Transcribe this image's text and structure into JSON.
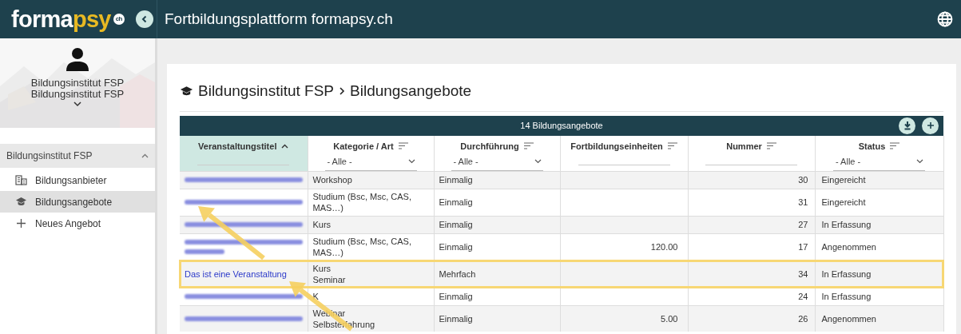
{
  "header": {
    "logo": {
      "brand": "forma",
      "accent": "psy",
      "badge": "ch"
    },
    "title": "Fortbildungsplattform formapsy.ch"
  },
  "profile": {
    "lines": [
      "Bildungsinstitut FSP",
      "Bildungsinstitut FSP"
    ]
  },
  "nav": {
    "group": {
      "label": "Bildungsinstitut FSP",
      "expanded": true
    },
    "items": [
      {
        "kind": "building",
        "label": "Bildungsanbieter",
        "selected": false
      },
      {
        "kind": "cap",
        "label": "Bildungsangebote",
        "selected": true
      },
      {
        "kind": "plus",
        "label": "Neues Angebot",
        "selected": false
      }
    ]
  },
  "breadcrumb": [
    "Bildungsinstitut FSP",
    "Bildungsangebote"
  ],
  "table": {
    "caption": "14 Bildungsangebote",
    "columns": [
      {
        "label": "Veranstaltungstitel",
        "sorted": true
      },
      {
        "label": "Kategorie / Art",
        "sorted": false,
        "filter": "- Alle -"
      },
      {
        "label": "Durchführung",
        "sorted": false,
        "filter": "- Alle -"
      },
      {
        "label": "Fortbildungseinheiten",
        "sorted": false
      },
      {
        "label": "Nummer",
        "sorted": false
      },
      {
        "label": "Status",
        "sorted": false,
        "filter": "- Alle -"
      }
    ],
    "rows": [
      {
        "kind": "blurred",
        "category": [
          "Workshop"
        ],
        "mode": "Einmalig",
        "units": "",
        "number": "30",
        "status": "Eingereicht",
        "highlighted": false
      },
      {
        "kind": "blurred",
        "category": [
          "Studium (Bsc, Msc, CAS, MAS…)"
        ],
        "mode": "Einmalig",
        "units": "",
        "number": "31",
        "status": "Eingereicht",
        "highlighted": false
      },
      {
        "kind": "blurred",
        "category": [
          "Kurs"
        ],
        "mode": "Einmalig",
        "units": "",
        "number": "27",
        "status": "In Erfassung",
        "highlighted": false
      },
      {
        "kind": "blurredpair",
        "category": [
          "Studium (Bsc, Msc, CAS, MAS…)"
        ],
        "mode": "Einmalig",
        "units": "120.00",
        "number": "17",
        "status": "Angenommen",
        "highlighted": false
      },
      {
        "kind": "link",
        "title": "Das ist eine Veranstaltung",
        "category": [
          "Kurs",
          "Seminar"
        ],
        "mode": "Mehrfach",
        "units": "",
        "number": "34",
        "status": "In Erfassung",
        "highlighted": true
      },
      {
        "kind": "blurred",
        "category": [
          "K"
        ],
        "mode": "Einmalig",
        "units": "",
        "number": "24",
        "status": "In Erfassung",
        "highlighted": false
      },
      {
        "kind": "blurred",
        "category": [
          "Webinar",
          "Selbsterfahrung"
        ],
        "mode": "Einmalig",
        "units": "5.00",
        "number": "26",
        "status": "Angenommen",
        "highlighted": false
      }
    ]
  },
  "annotations": [
    {
      "kind": "arrow"
    },
    {
      "kind": "arrow"
    }
  ]
}
